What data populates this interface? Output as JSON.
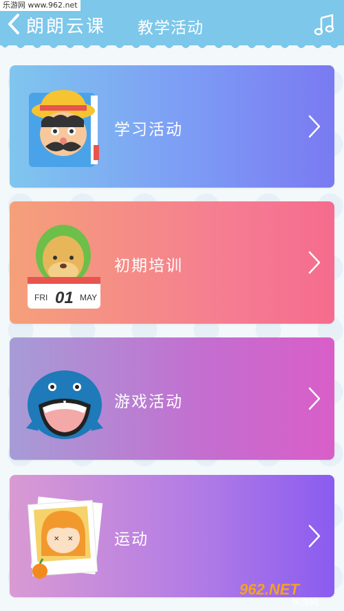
{
  "watermark": {
    "site": "乐游网 www.962.net",
    "logo_text": "962.NET",
    "logo_sub": "乐游网"
  },
  "header": {
    "app_name": "朗朗云课",
    "title": "教学活动",
    "bg_color": "#7cc7ea"
  },
  "cards": [
    {
      "label": "学习活动",
      "icon": "boy-with-hat-book-icon"
    },
    {
      "label": "初期培训",
      "icon": "calendar-dog-icon",
      "calendar": {
        "day_name": "FRI",
        "day": "01",
        "month": "MAY"
      }
    },
    {
      "label": "游戏活动",
      "icon": "whale-icon"
    },
    {
      "label": "运动",
      "icon": "girl-photo-icon"
    }
  ]
}
